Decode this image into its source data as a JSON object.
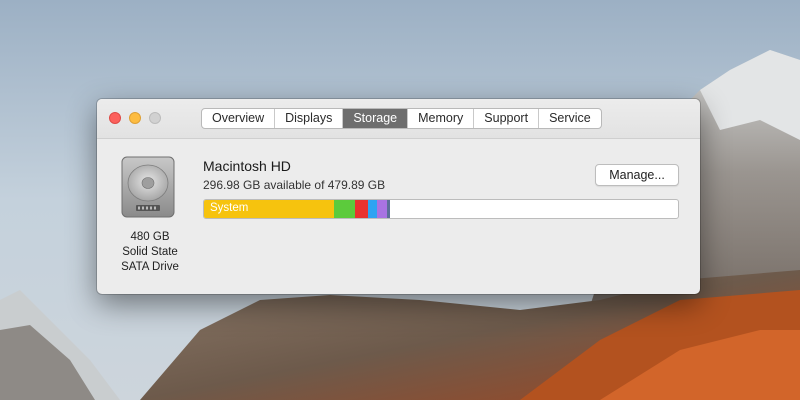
{
  "window": {
    "tabs": [
      {
        "label": "Overview",
        "active": false
      },
      {
        "label": "Displays",
        "active": false
      },
      {
        "label": "Storage",
        "active": true
      },
      {
        "label": "Memory",
        "active": false
      },
      {
        "label": "Support",
        "active": false
      },
      {
        "label": "Service",
        "active": false
      }
    ]
  },
  "disk": {
    "icon": "hard-drive-icon",
    "capacity": "480 GB",
    "type": "Solid State",
    "interface": "SATA Drive"
  },
  "volume": {
    "name": "Macintosh HD",
    "available": "296.98 GB available of 479.89 GB",
    "manage_label": "Manage..."
  },
  "storage_bar": {
    "segments": [
      {
        "name": "system",
        "label": "System",
        "fraction": 0.275,
        "color": "#f6c30e"
      },
      {
        "name": "green",
        "label": "",
        "fraction": 0.044,
        "color": "#5ccb3c"
      },
      {
        "name": "red",
        "label": "",
        "fraction": 0.028,
        "color": "#e9322f"
      },
      {
        "name": "blue",
        "label": "",
        "fraction": 0.02,
        "color": "#2ea3f2"
      },
      {
        "name": "purple",
        "label": "",
        "fraction": 0.021,
        "color": "#a873e2"
      },
      {
        "name": "slate",
        "label": "",
        "fraction": 0.006,
        "color": "#5b6e99"
      }
    ]
  }
}
